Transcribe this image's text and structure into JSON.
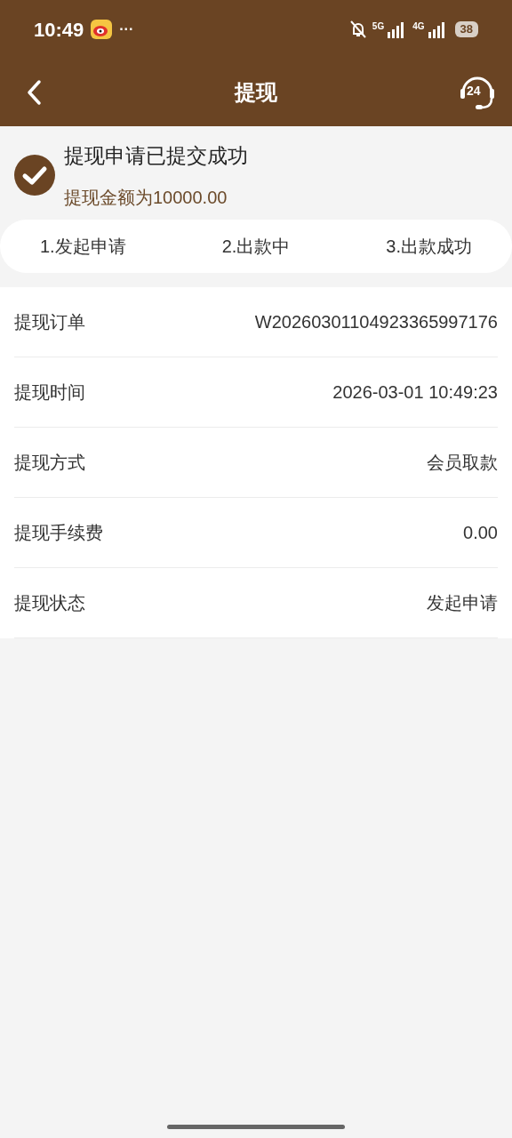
{
  "status_bar": {
    "time": "10:49",
    "more": "···",
    "network_1": "5G",
    "network_2": "4G",
    "battery": "38"
  },
  "header": {
    "title": "提现",
    "support_badge": "24"
  },
  "result": {
    "title": "提现申请已提交成功",
    "amount": "提现金额为10000.00"
  },
  "steps": [
    "1.发起申请",
    "2.出款中",
    "3.出款成功"
  ],
  "details": [
    {
      "label": "提现订单",
      "value": "W20260301104923365997176"
    },
    {
      "label": "提现时间",
      "value": "2026-03-01 10:49:23"
    },
    {
      "label": "提现方式",
      "value": "会员取款"
    },
    {
      "label": "提现手续费",
      "value": "0.00"
    },
    {
      "label": "提现状态",
      "value": "发起申请"
    }
  ]
}
